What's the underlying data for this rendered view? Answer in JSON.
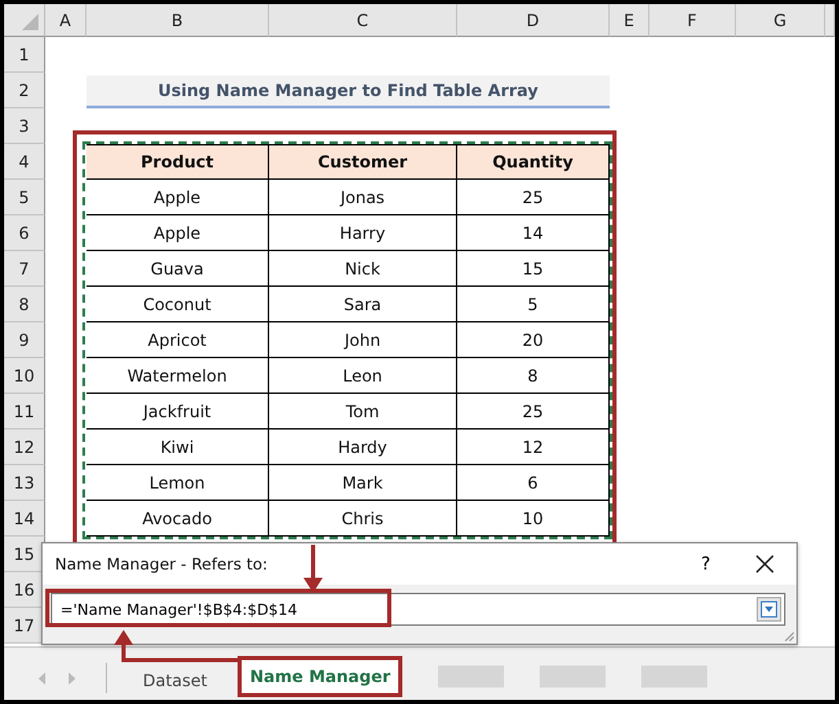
{
  "column_headers": [
    "A",
    "B",
    "C",
    "D",
    "E",
    "F",
    "G"
  ],
  "row_headers": [
    "1",
    "2",
    "3",
    "4",
    "5",
    "6",
    "7",
    "8",
    "9",
    "10",
    "11",
    "12",
    "13",
    "14",
    "15",
    "16",
    "17"
  ],
  "title": "Using Name Manager to Find Table Array",
  "table": {
    "columns": [
      "Product",
      "Customer",
      "Quantity"
    ],
    "rows": [
      [
        "Apple",
        "Jonas",
        "25"
      ],
      [
        "Apple",
        "Harry",
        "14"
      ],
      [
        "Guava",
        "Nick",
        "15"
      ],
      [
        "Coconut",
        "Sara",
        "5"
      ],
      [
        "Apricot",
        "John",
        "20"
      ],
      [
        "Watermelon",
        "Leon",
        "8"
      ],
      [
        "Jackfruit",
        "Tom",
        "25"
      ],
      [
        "Kiwi",
        "Hardy",
        "12"
      ],
      [
        "Lemon",
        "Mark",
        "6"
      ],
      [
        "Avocado",
        "Chris",
        "10"
      ]
    ]
  },
  "dialog": {
    "title": "Name Manager - Refers to:",
    "help": "?",
    "refers_to": "='Name Manager'!$B$4:$D$14"
  },
  "sheet_tabs": [
    {
      "label": "Dataset",
      "selected": false
    },
    {
      "label": "Name Manager",
      "selected": true
    }
  ]
}
